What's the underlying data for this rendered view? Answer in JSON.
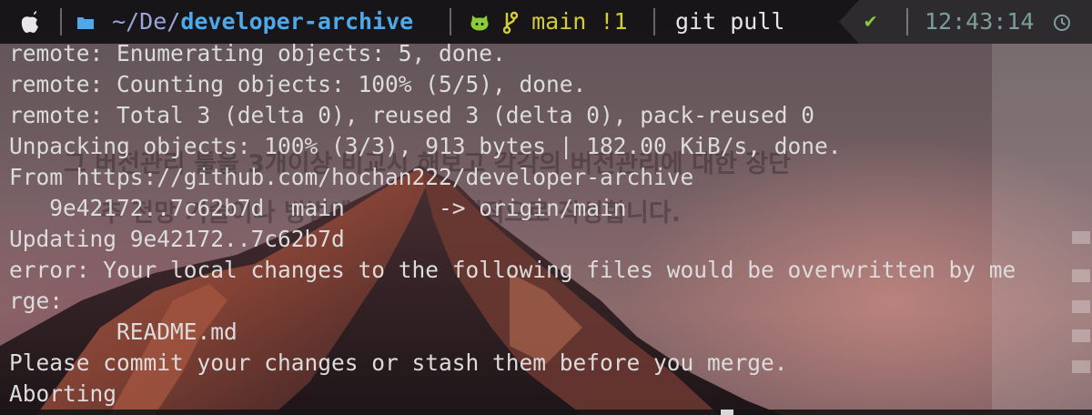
{
  "prompt": {
    "apple_icon": "apple-logo-icon",
    "folder_icon": "folder-icon",
    "path_prefix": "~/De/",
    "path_current": "developer-archive",
    "github_icon": "github-icon",
    "branch_icon": "git-branch-icon",
    "branch": "main",
    "modified_count": "!1",
    "command": "git pull",
    "status_check": "✔",
    "time": "12:43:14",
    "clock_icon": "clock-icon"
  },
  "output": [
    "remote: Enumerating objects: 5, done.",
    "remote: Counting objects: 100% (5/5), done.",
    "remote: Total 3 (delta 0), reused 3 (delta 0), pack-reused 0",
    "Unpacking objects: 100% (3/3), 913 bytes | 182.00 KiB/s, done.",
    "From https://github.com/hochan222/developer-archive",
    "   9e42172..7c62b7d  main       -> origin/main",
    "Updating 9e42172..7c62b7d",
    "error: Your local changes to the following files would be overwritten by me",
    "rge:",
    "        README.md",
    "Please commit your changes or stash them before you merge.",
    "Aborting"
  ],
  "colors": {
    "prompt_bg": "#161416",
    "path": "#4fa8e8",
    "branch": "#d2cc38",
    "github": "#8ccc3a",
    "check": "#8ccc3a",
    "time": "#7d9e98",
    "text": "#dcdcdc"
  }
}
